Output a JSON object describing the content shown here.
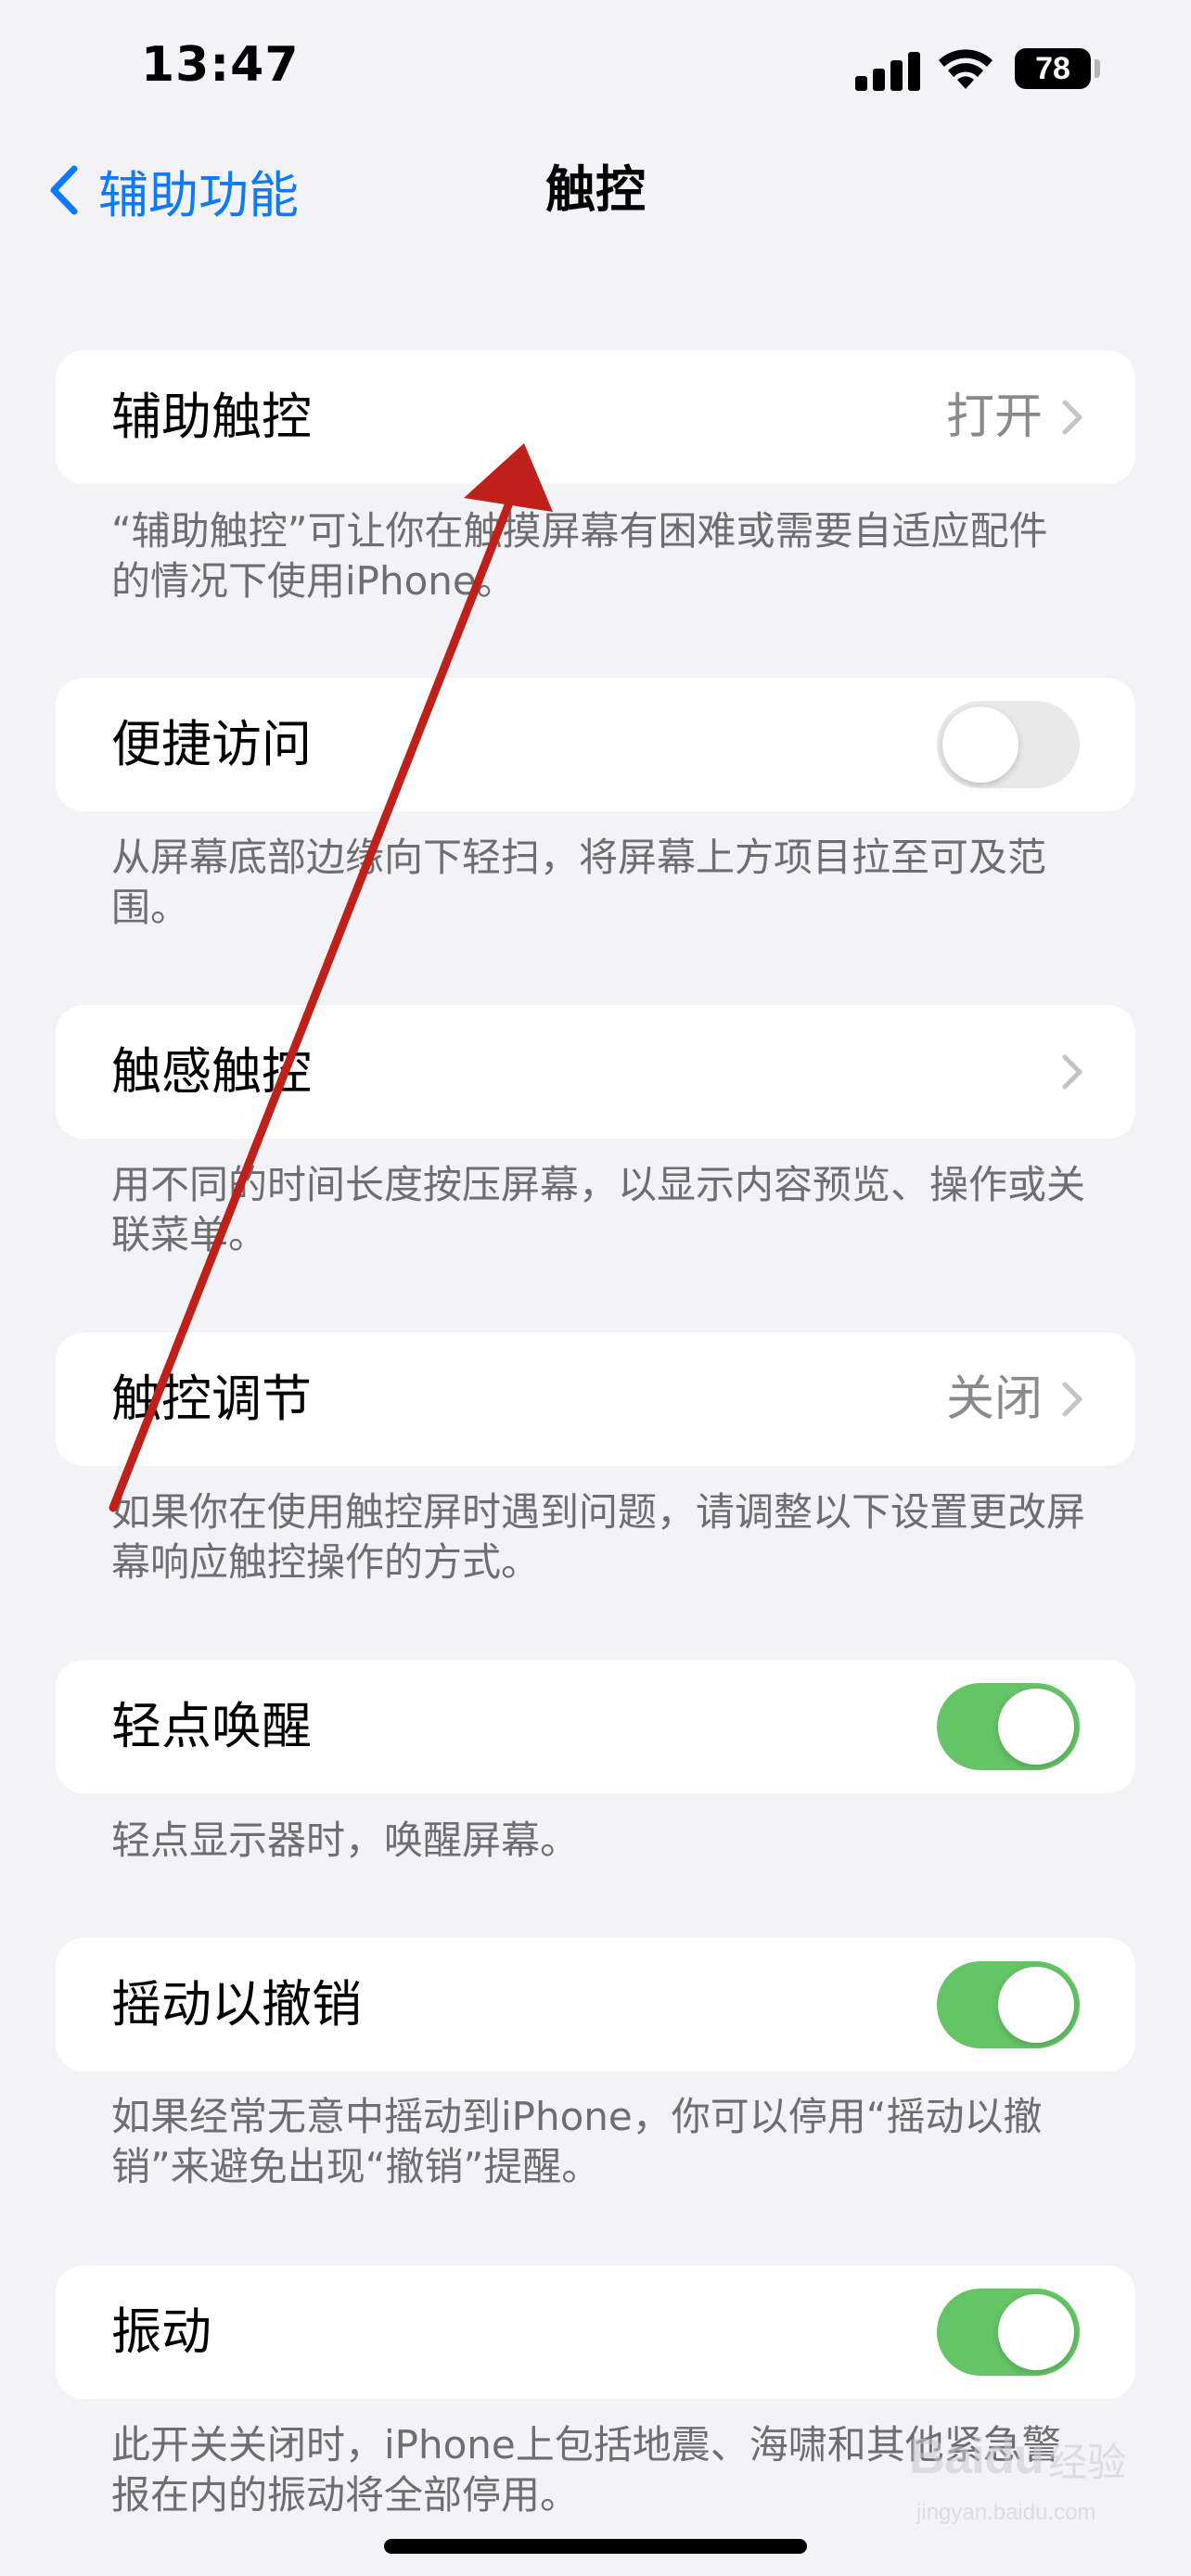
{
  "status_bar": {
    "time": "13:47",
    "battery": "78"
  },
  "nav": {
    "back_label": "辅助功能",
    "title": "触控"
  },
  "sections": [
    {
      "label": "辅助触控",
      "value": "打开",
      "footer": "“辅助触控”可让你在触摸屏幕有困难或需要自适应配件的情况下使用iPhone。"
    },
    {
      "label": "便捷访问",
      "toggle": "off",
      "footer": "从屏幕底部边缘向下轻扫，将屏幕上方项目拉至可及范围。"
    },
    {
      "label": "触感触控",
      "footer": "用不同的时间长度按压屏幕，以显示内容预览、操作或关联菜单。"
    },
    {
      "label": "触控调节",
      "value": "关闭",
      "footer": "如果你在使用触控屏时遇到问题，请调整以下设置更改屏幕响应触控操作的方式。"
    },
    {
      "label": "轻点唤醒",
      "toggle": "on",
      "footer": "轻点显示器时，唤醒屏幕。"
    },
    {
      "label": "摇动以撤销",
      "toggle": "on",
      "footer": "如果经常无意中摇动到iPhone，你可以停用“摇动以撤销”来避免出现“撤销”提醒。"
    },
    {
      "label": "振动",
      "toggle": "on",
      "footer": "此开关关闭时，iPhone上包括地震、海啸和其他紧急警报在内的振动将全部停用。"
    }
  ],
  "watermark": {
    "logo": "Baidu",
    "text": "经验",
    "url": "jingyan.baidu.com"
  },
  "colors": {
    "accent": "#0a7aff",
    "toggle_on": "#65c466",
    "annotation_arrow": "#c0201a"
  }
}
